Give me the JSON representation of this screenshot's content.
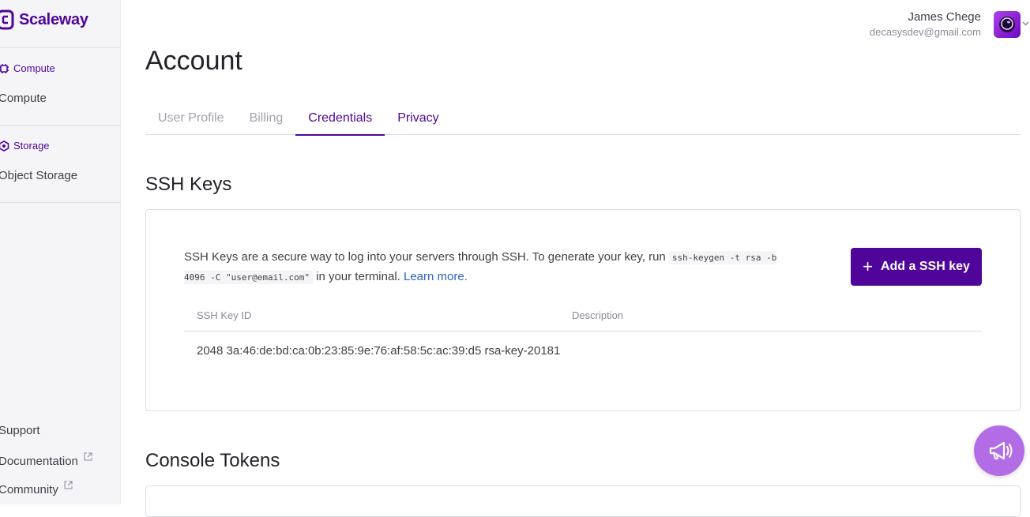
{
  "brand": {
    "name": "Scaleway"
  },
  "sidebar": {
    "sections": [
      {
        "label": "Compute",
        "icon": "chip-icon",
        "items": [
          "Compute"
        ]
      },
      {
        "label": "Storage",
        "icon": "hexagon-icon",
        "items": [
          "Object Storage"
        ]
      }
    ],
    "footer": {
      "support": "Support",
      "documentation": "Documentation",
      "community": "Community"
    }
  },
  "user": {
    "name": "James Chege",
    "email": "decasysdev@gmail.com"
  },
  "page": {
    "title": "Account",
    "tabs": [
      {
        "label": "User Profile",
        "active": false
      },
      {
        "label": "Billing",
        "active": false
      },
      {
        "label": "Credentials",
        "active": true
      },
      {
        "label": "Privacy",
        "active": false
      }
    ]
  },
  "ssh": {
    "title": "SSH Keys",
    "desc_before": "SSH Keys are a secure way to log into your servers through SSH. To generate your key, run ",
    "code": "ssh-keygen -t rsa -b 4096 -C \"user@email.com\"",
    "desc_after": " in your terminal. ",
    "learn_more": "Learn more.",
    "add_button": "Add a SSH key",
    "table": {
      "columns": [
        "SSH Key ID",
        "Description"
      ],
      "rows": [
        {
          "id": "2048 3a:46:de:bd:ca:0b:23:85:9e:76:af:58:5c:ac:39:d5 rsa-key-20181",
          "description": ""
        }
      ]
    }
  },
  "tokens": {
    "title": "Console Tokens"
  },
  "colors": {
    "accent": "#4f0599",
    "link": "#2d62c9",
    "fab": "#b26de6"
  }
}
